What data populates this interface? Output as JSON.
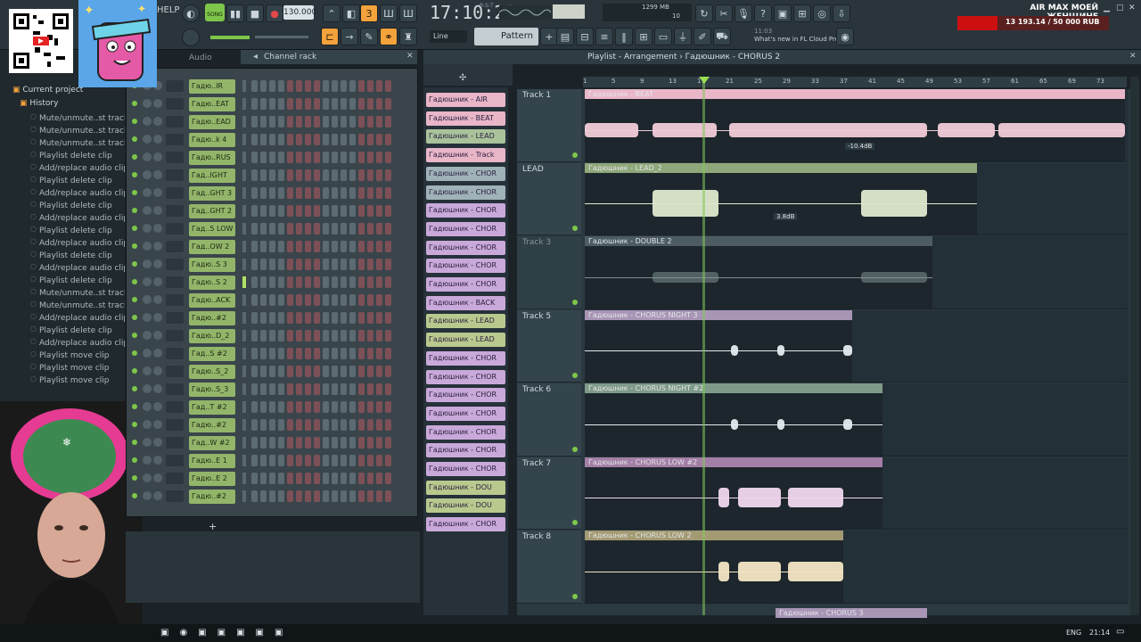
{
  "topbar": {
    "help": "HELP",
    "song_mode": "SONG",
    "tempo": "130.000",
    "time": "17:10:20",
    "time_sub": "B:S:T",
    "memory": "1299 MB",
    "cpu_value": "10",
    "pattern": "Pattern 1",
    "snap": "Line",
    "news_time": "11:03",
    "news_text": "What's new in FL Cloud Pro?",
    "promo_title": "AIR MAX МОЕЙ ЖЕНЩИНЕ",
    "promo_value": "13 193.14 / 50 000 RUB",
    "accent_green": "#7ec64a",
    "accent_orange": "#f4a23c"
  },
  "browser": {
    "section_audio": "Audio",
    "root": "Current project",
    "history": "History",
    "items": [
      "Mute/unmute..st track(s)",
      "Mute/unmute..st track(s)",
      "Mute/unmute..st track(s)",
      "Playlist delete clip",
      "Add/replace audio clip",
      "Playlist delete clip",
      "Add/replace audio clip",
      "Playlist delete clip",
      "Add/replace audio clip",
      "Playlist delete clip",
      "Add/replace audio clip",
      "Playlist delete clip",
      "Add/replace audio clip",
      "Playlist delete clip",
      "Mute/unmute..st track(s)",
      "Mute/unmute..st track(s)",
      "Add/replace audio clip",
      "Playlist delete clip",
      "Add/replace audio clip",
      "Playlist move clip",
      "Playlist move clip",
      "Playlist move clip"
    ]
  },
  "channel_rack": {
    "title": "Channel rack",
    "channels": [
      "Гадю..IR",
      "Гадю..EAT",
      "Гадю..EAD",
      "Гадю..k 4",
      "Гадю..RUS",
      "Гад..IGHT",
      "Гад..GHT 3",
      "Гад..GHT 2",
      "Гад..5 LOW",
      "Гад..OW 2",
      "Гадю..S 3",
      "Гадю..S 2",
      "Гадю..ACK",
      "Гадю..#2",
      "Гадю..D_2",
      "Гад..S #2",
      "Гадю..S_2",
      "Гадю..S_3",
      "Гад..T #2",
      "Гадю..#2",
      "Гад..W #2",
      "Гадю..E 1",
      "Гадю..E 2",
      "Гадю..#2"
    ]
  },
  "picker": {
    "clips": [
      "Гадюшник - AIR",
      "Гадюшник - BEAT",
      "Гадюшник - LEAD",
      "Гадюшник - Track",
      "Гадюшник - CHOR",
      "Гадюшник - CHOR",
      "Гадюшник - CHOR",
      "Гадюшник - CHOR",
      "Гадюшник - CHOR",
      "Гадюшник - CHOR",
      "Гадюшник - CHOR",
      "Гадюшник - BACK",
      "Гадюшник - LEAD",
      "Гадюшник - LEAD",
      "Гадюшник - CHOR",
      "Гадюшник - CHOR",
      "Гадюшник - CHOR",
      "Гадюшник - CHOR",
      "Гадюшник - CHOR",
      "Гадюшник - CHOR",
      "Гадюшник - CHOR",
      "Гадюшник - DOU",
      "Гадюшник - DOU",
      "Гадюшник - CHOR"
    ],
    "colors": [
      "#e9b6c8",
      "#e9b6c8",
      "#a9c29a",
      "#e9b6c8",
      "#9fb2b8",
      "#9fb2b8",
      "#c9a9d9",
      "#c9a9d9",
      "#c9a9d9",
      "#c9a9d9",
      "#c9a9d9",
      "#c9a9d9",
      "#b9c98e",
      "#b9c98e",
      "#c9a9d9",
      "#c9a9d9",
      "#c9a9d9",
      "#c9a9d9",
      "#c9a9d9",
      "#c9a9d9",
      "#c9a9d9",
      "#b9c98e",
      "#b9c98e",
      "#c9a9d9"
    ]
  },
  "playlist": {
    "breadcrumb": "Playlist - Arrangement › Гадюшник - CHORUS 2",
    "ruler": [
      "1",
      "5",
      "9",
      "13",
      "17",
      "21",
      "25",
      "29",
      "33",
      "37",
      "41",
      "45",
      "49",
      "53",
      "57",
      "61",
      "65",
      "69",
      "73"
    ],
    "tracks": [
      {
        "name": "Track 1",
        "clip": "Гадюшник - BEAT",
        "color": "#e9b6c8",
        "fill": "#f1cbd7",
        "gain": "-10.4dB"
      },
      {
        "name": "LEAD",
        "clip": "Гадюшник - LEAD_2",
        "color": "#8fa77a",
        "fill": "#dfe9cf",
        "gain": "3.8dB"
      },
      {
        "name": "Track 3",
        "clip": "Гадюшник - DOUBLE 2",
        "color": "#4d5c63",
        "fill": "#7f8f93",
        "gain": ""
      },
      {
        "name": "Track 5",
        "clip": "Гадюшник - CHORUS NIGHT 3",
        "color": "#a895b6",
        "fill": "#e3ecef",
        "gain": ""
      },
      {
        "name": "Track 6",
        "clip": "Гадюшник - CHORUS NIGHT #2",
        "color": "#7f9a89",
        "fill": "#e3ecef",
        "gain": ""
      },
      {
        "name": "Track 7",
        "clip": "Гадюшник - CHORUS LOW #2",
        "color": "#a37ea6",
        "fill": "#f1d7ee",
        "gain": ""
      },
      {
        "name": "Track 8",
        "clip": "Гадюшник - CHORUS LOW 2",
        "color": "#a39a73",
        "fill": "#f3e6c4",
        "gain": ""
      }
    ],
    "next_clip": "Гадюшник - CHORUS 3"
  },
  "taskbar": {
    "lang": "ENG",
    "clock": "21:14"
  }
}
